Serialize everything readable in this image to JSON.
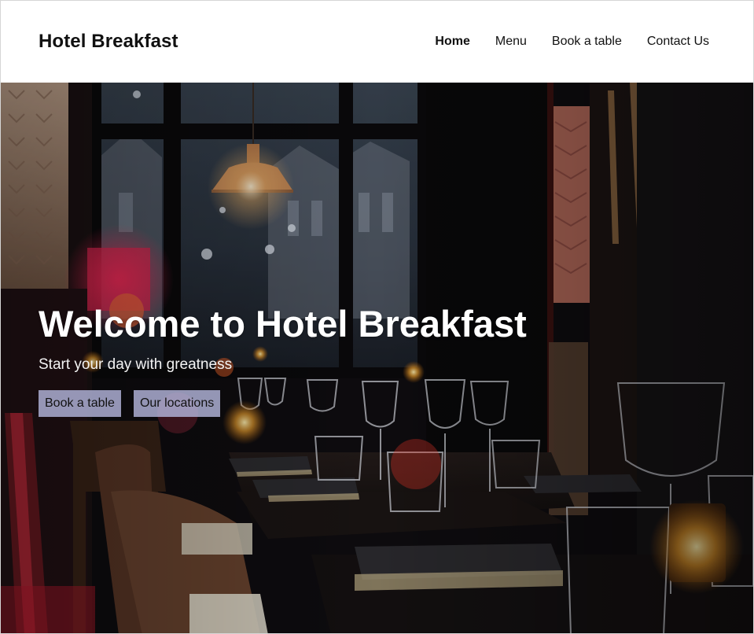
{
  "header": {
    "brand": "Hotel Breakfast",
    "nav": [
      "Home",
      "Menu",
      "Book a table",
      "Contact Us"
    ]
  },
  "hero": {
    "title": "Welcome to Hotel Breakfast",
    "subtitle": "Start your day with greatness",
    "actions": [
      "Book a table",
      "Our locations"
    ]
  }
}
